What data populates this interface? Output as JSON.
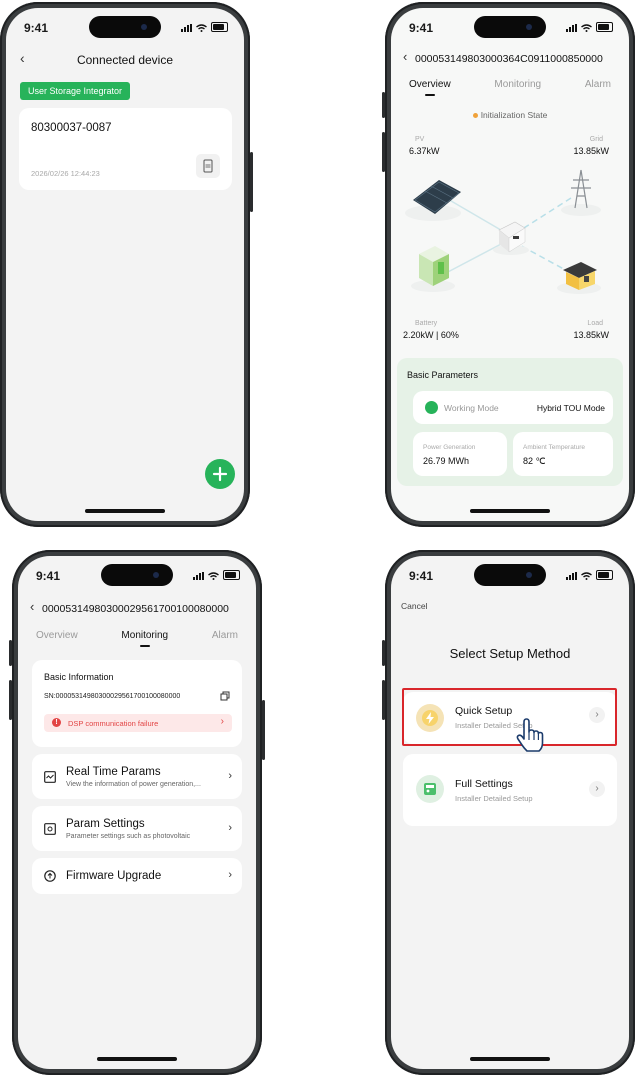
{
  "status_time": "9:41",
  "screen1": {
    "title": "Connected device",
    "back_icon": "chevron-left-icon",
    "tag": "User Storage Integrator",
    "device": {
      "name": "80300037-0087",
      "timestamp": "2026/02/26 12:44:23",
      "icon": "inverter-icon"
    },
    "fab_icon": "plus-icon",
    "accent": "#27b35a"
  },
  "screen2": {
    "title": "0000531498030003 64C0911000850000",
    "title_full": "00005314980300 0364C0911000850000",
    "header": "000053149803000364C0911000850000",
    "tabs": [
      "Overview",
      "Monitoring",
      "Alarm"
    ],
    "state": "Initialization State",
    "pv": {
      "label": "PV",
      "value": "6.37kW"
    },
    "grid": {
      "label": "Grid",
      "value": "13.85kW"
    },
    "battery": {
      "label": "Battery",
      "value": "2.20kW | 60%"
    },
    "load": {
      "label": "Load",
      "value": "13.85kW"
    },
    "basic_title": "Basic Parameters",
    "working_mode_label": "Working Mode",
    "working_mode_value": "Hybrid TOU Mode",
    "power_gen_label": "Power Generation",
    "power_gen_value": "26.79 MWh",
    "ambient_label": "Ambient Temperature",
    "ambient_value": "82 ℃"
  },
  "screen3": {
    "header": "000053149803000295617001000800 00",
    "header_text": "0000531498030002956170010008000​0",
    "title": "00005314980300029561700100080000",
    "tabs": [
      "Overview",
      "Monitoring",
      "Alarm"
    ],
    "basic_info": "Basic Information",
    "sn": "SN:00005314980300029561700100080000",
    "alert": "DSP communication failure",
    "items": [
      {
        "title": "Real Time Params",
        "sub": "View the information of power generation,...",
        "icon": "chart-icon"
      },
      {
        "title": "Param Settings",
        "sub": "Parameter settings such as photovoltaic",
        "icon": "settings-icon"
      },
      {
        "title": "Firmware Upgrade",
        "sub": "",
        "icon": "upgrade-icon"
      }
    ]
  },
  "screen4": {
    "cancel": "Cancel",
    "title": "Select Setup Method",
    "options": [
      {
        "title": "Quick Setup",
        "sub": "Installer Detailed Setup",
        "icon": "quick-setup-icon"
      },
      {
        "title": "Full Settings",
        "sub": "Installer Detailed Setup",
        "icon": "full-settings-icon"
      }
    ],
    "highlight_color": "#d9262b"
  }
}
